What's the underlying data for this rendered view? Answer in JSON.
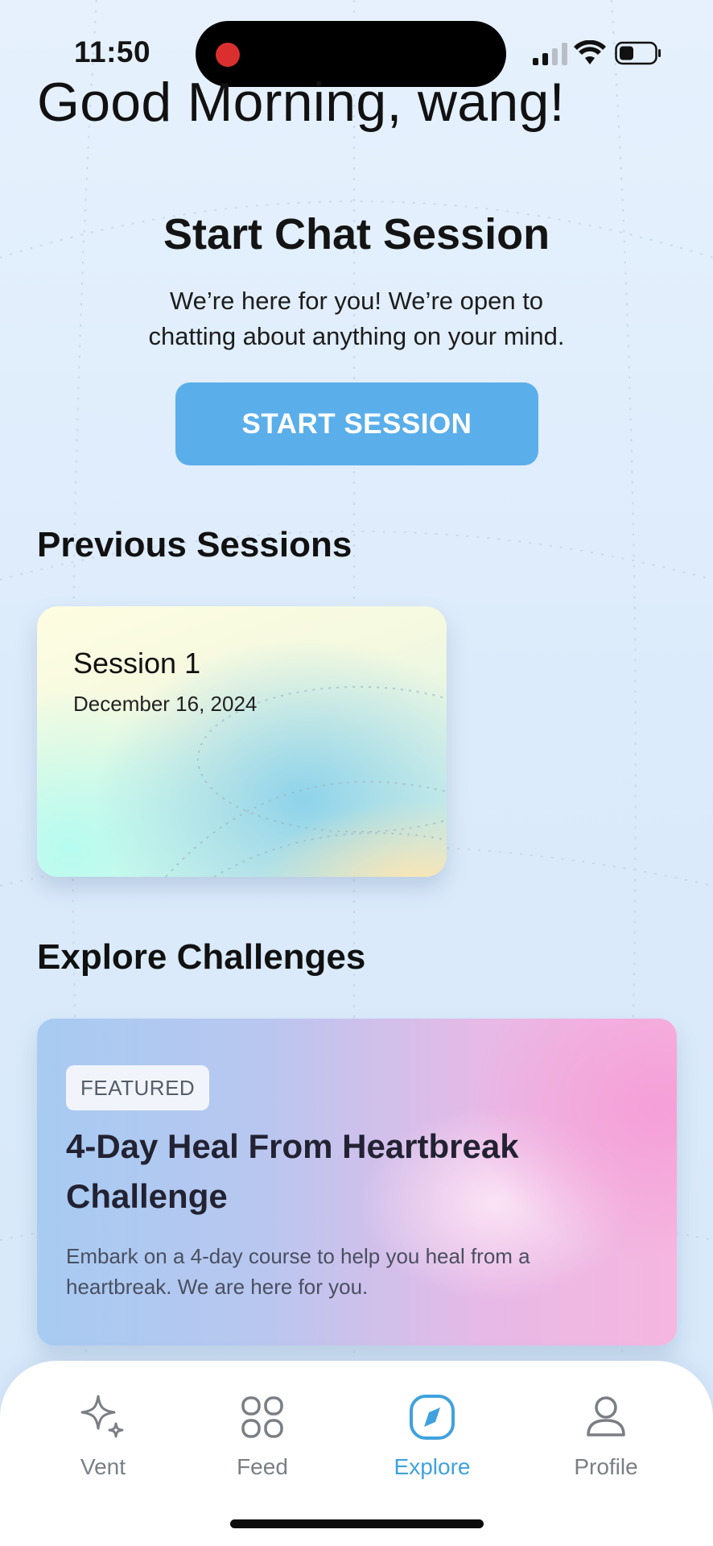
{
  "status_bar": {
    "time": "11:50"
  },
  "greeting": "Good Morning, wang!",
  "chat": {
    "title": "Start Chat Session",
    "subtitle_line1": "We’re here for you! We’re open to",
    "subtitle_line2": "chatting about anything on your mind.",
    "button_label": "START SESSION"
  },
  "previous_sessions": {
    "title": "Previous Sessions",
    "items": [
      {
        "name": "Session 1",
        "date": "December 16, 2024"
      }
    ]
  },
  "explore": {
    "title": "Explore Challenges",
    "featured": {
      "badge": "FEATURED",
      "title": "4-Day Heal From Heartbreak Challenge",
      "description": "Embark on a 4-day course to help you heal from a heartbreak. We are here for you."
    }
  },
  "tabbar": {
    "active": "Explore",
    "accent_color": "#3fa2dd",
    "items": [
      {
        "label": "Vent",
        "icon": "sparkle-icon"
      },
      {
        "label": "Feed",
        "icon": "grid-icon"
      },
      {
        "label": "Explore",
        "icon": "compass-icon"
      },
      {
        "label": "Profile",
        "icon": "person-icon"
      }
    ]
  },
  "colors": {
    "start_button": "#5aaeea",
    "background": "#e0edfb"
  }
}
